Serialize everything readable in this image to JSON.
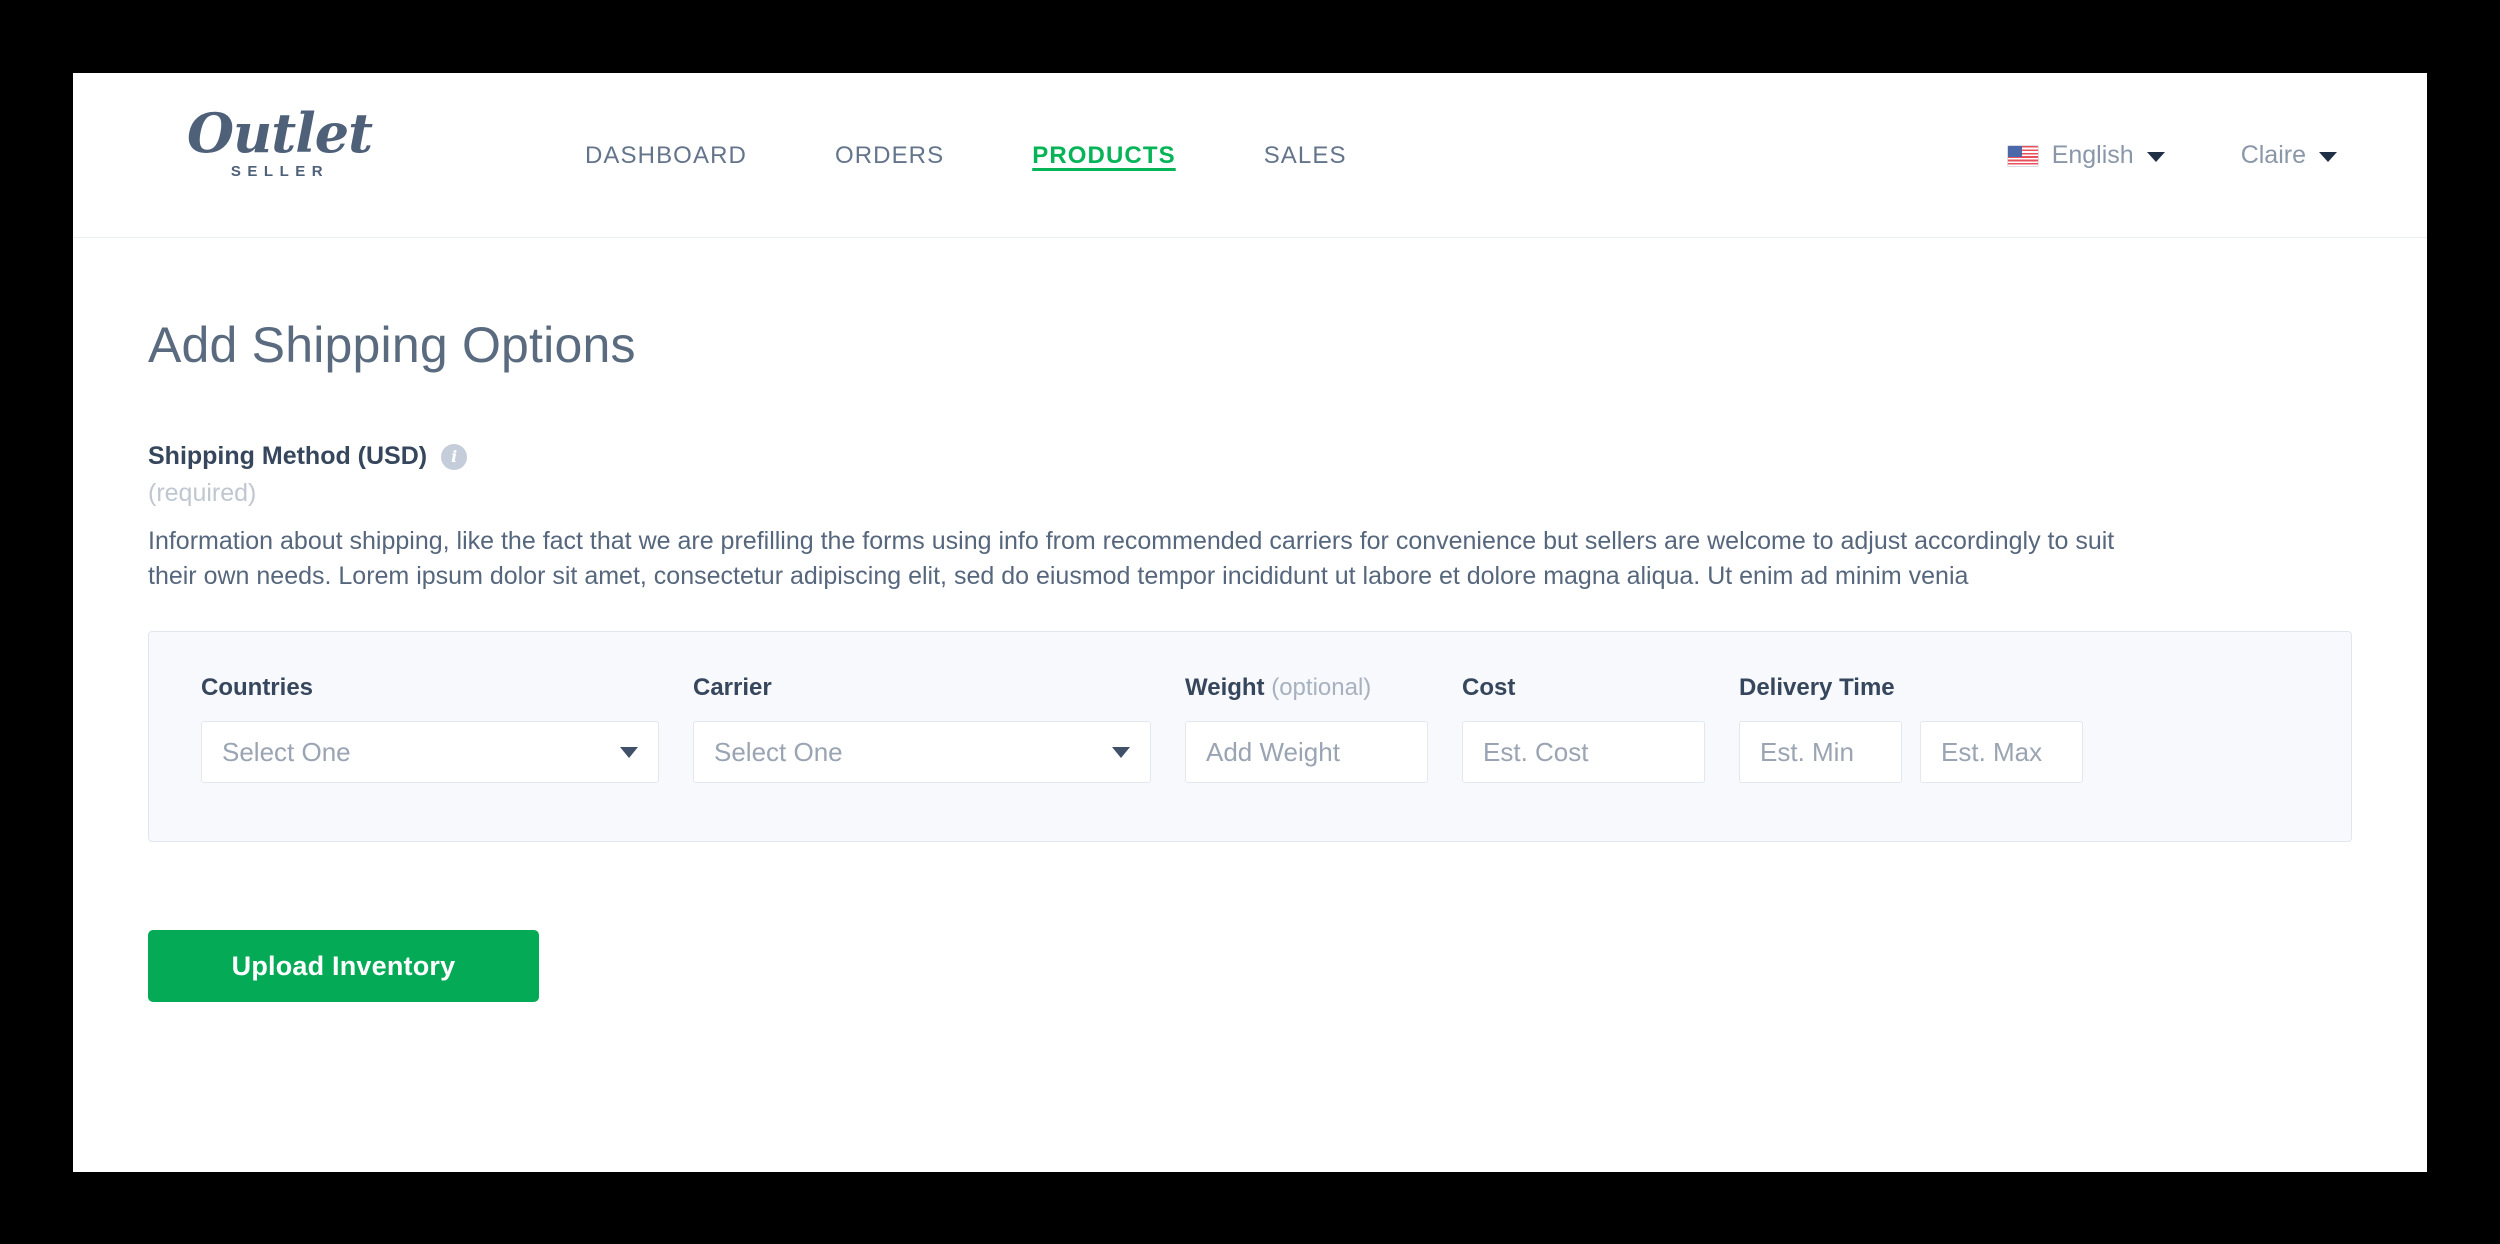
{
  "header": {
    "brand": {
      "script": "Outlet",
      "sub": "SELLER",
      "color": "#4e6179"
    },
    "nav": [
      {
        "label": "DASHBOARD",
        "active": false
      },
      {
        "label": "ORDERS",
        "active": false
      },
      {
        "label": "PRODUCTS",
        "active": true
      },
      {
        "label": "SALES",
        "active": false
      }
    ],
    "language": {
      "label": "English",
      "flag": "us-flag-icon"
    },
    "user": {
      "label": "Claire"
    },
    "accent_active": "#05b457",
    "nav_inactive_color": "#64748b"
  },
  "main": {
    "page_title": "Add Shipping Options",
    "group": {
      "label": "Shipping Method (USD)",
      "info_icon": "info-icon",
      "info_glyph": "i",
      "required_note": "(required)",
      "description": "Information about shipping, like the fact that we are prefilling the forms using info from recommended carriers for convenience but sellers are welcome to adjust accordingly to suit their own needs. Lorem ipsum dolor sit amet, consectetur adipiscing elit, sed do eiusmod tempor incididunt ut labore et dolore magna aliqua. Ut enim ad minim venia"
    },
    "form": {
      "countries": {
        "label": "Countries",
        "placeholder": "Select One",
        "value": "",
        "type": "select"
      },
      "carrier": {
        "label": "Carrier",
        "placeholder": "Select One",
        "value": "",
        "type": "select"
      },
      "weight": {
        "label": "Weight",
        "label_suffix": "(optional)",
        "placeholder": "Add Weight",
        "value": "",
        "type": "text"
      },
      "cost": {
        "label": "Cost",
        "placeholder": "Est. Cost",
        "value": "",
        "type": "text"
      },
      "delivery_time": {
        "label": "Delivery Time",
        "min_placeholder": "Est. Min",
        "max_placeholder": "Est. Max",
        "min_value": "",
        "max_value": ""
      }
    },
    "submit": {
      "label": "Upload Inventory",
      "color": "#05aa56"
    }
  },
  "colors": {
    "panel_bg": "#f7f9fc",
    "panel_border": "#e1e6ee",
    "text_navy": "#36465c",
    "text_body": "#56677d",
    "placeholder": "#9aa4b2",
    "muted": "#c0c7d1"
  }
}
